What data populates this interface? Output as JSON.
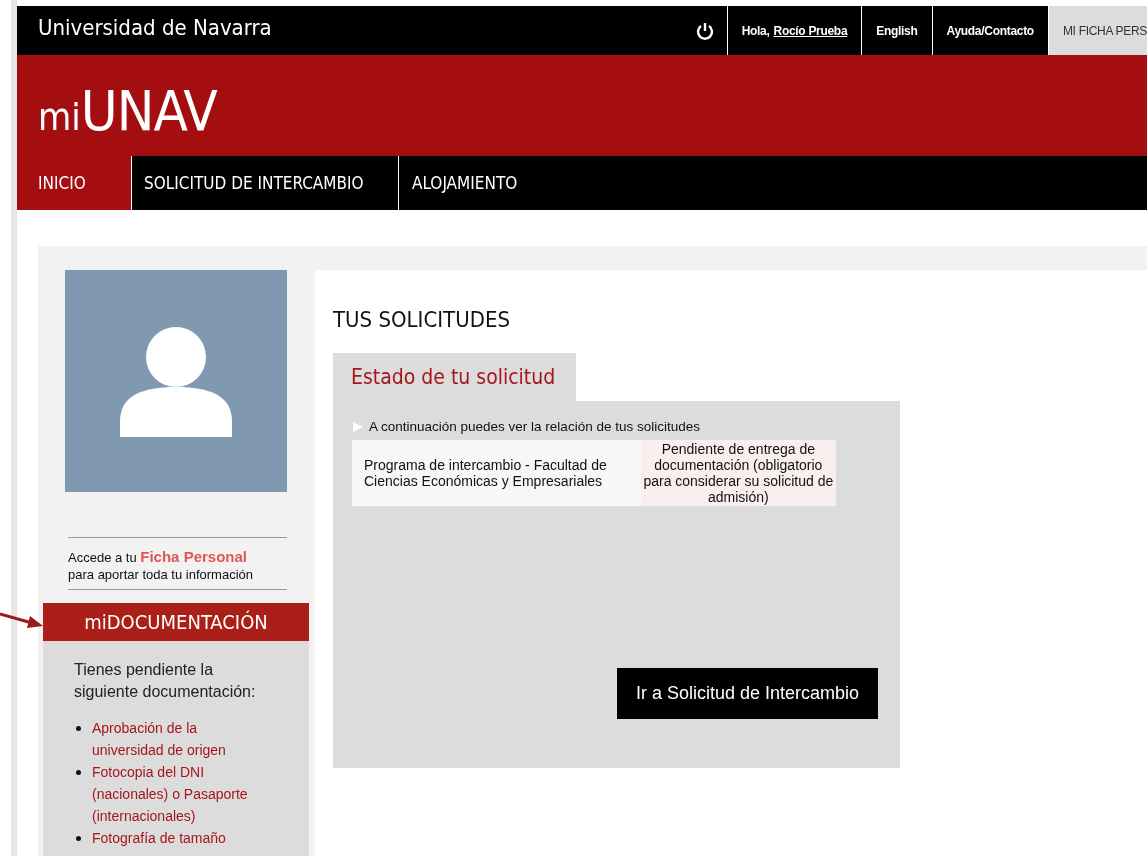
{
  "top_bar": {
    "title": "Universidad de Navarra",
    "greeting": "Hola,",
    "user": "Rocío Prueba",
    "links": [
      {
        "label": "English",
        "selected": false
      },
      {
        "label": "Ayuda/Contacto",
        "selected": false
      },
      {
        "label": "MI FICHA PERS",
        "selected": true
      }
    ]
  },
  "brand": {
    "prefix": "mi",
    "name": "UNAV"
  },
  "nav": [
    {
      "label": "INICIO",
      "selected": true
    },
    {
      "label": "SOLICITUD DE INTERCAMBIO",
      "selected": false
    },
    {
      "label": "ALOJAMIENTO",
      "selected": false
    }
  ],
  "sidebar": {
    "ficha_text": [
      "Accede a tu",
      "Ficha Personal",
      "para aportar toda tu información"
    ],
    "doc_title": "miDOCUMENTACIÓN",
    "doc_intro": "Tienes pendiente la siguiente documentación:",
    "doc_items": [
      "Aprobación de la universidad de origen",
      "Fotocopia del DNI (nacionales) o Pasaporte (internacionales)",
      "Fotografía de tamaño"
    ]
  },
  "main": {
    "heading": "TUS SOLICITUDES",
    "tab": "Estado de tu solicitud",
    "intro": "A continuación puedes ver la relación de tus solicitudes",
    "rows": [
      {
        "program": "Programa de intercambio - Facultad de Ciencias Económicas y Empresariales",
        "status": "Pendiente de entrega de documentación (obligatorio para considerar su solicitud de admisión)"
      }
    ],
    "button": "Ir a Solicitud de Intercambio"
  }
}
